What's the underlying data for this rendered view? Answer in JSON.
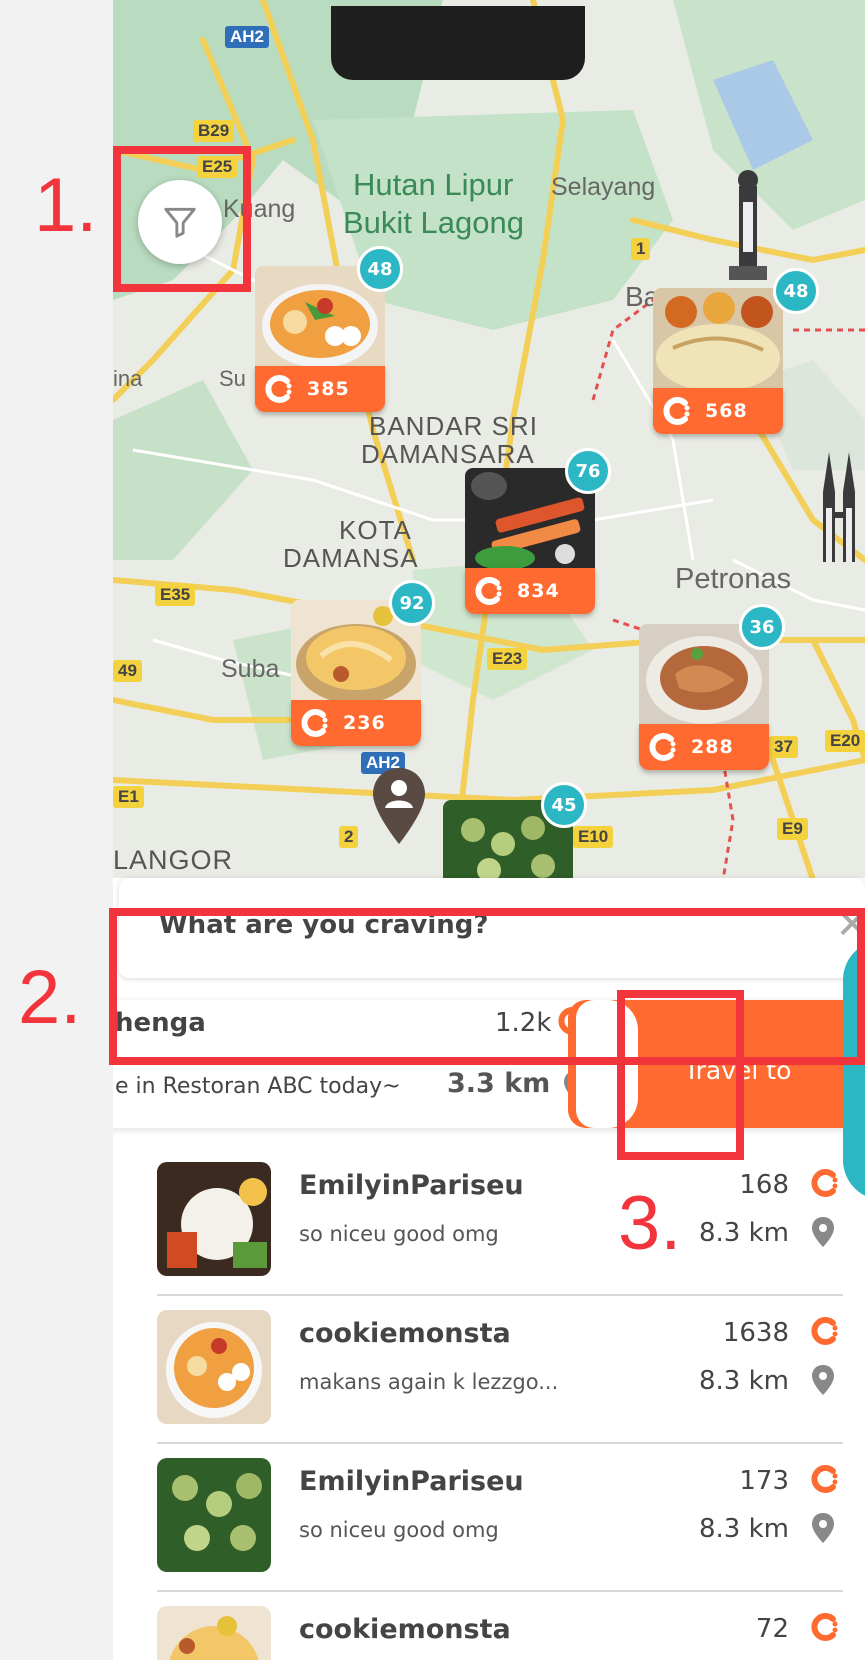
{
  "map": {
    "filter_icon": "filter-icon",
    "labels": {
      "hutan1": "Hutan Lipur",
      "hutan2": "Bukit Lagong",
      "selayang": "Selayang",
      "kuang": "Kuang",
      "bandar1": "BANDAR SRI",
      "bandar2": "DAMANSARA",
      "kota1": "KOTA",
      "kota2": "DAMANSA",
      "petronas": "Petronas",
      "suba": "Suba",
      "ina": "ina",
      "su": "Su",
      "ba": "Ba",
      "langor": "LANGOR"
    },
    "shields": {
      "ah2_top": "AH2",
      "b29": "B29",
      "e25": "E25",
      "e35": "E35",
      "e23": "E23",
      "ah2_mid": "AH2",
      "r2": "2",
      "e10": "E10",
      "e9": "E9",
      "e37": "37",
      "e20": "E20",
      "r1": "1",
      "r49": "49",
      "e1": "E1",
      "e35b": "E35"
    },
    "pins": [
      {
        "badge": "48",
        "value": "385"
      },
      {
        "badge": "48",
        "value": "568"
      },
      {
        "badge": "76",
        "value": "834"
      },
      {
        "badge": "92",
        "value": "236"
      },
      {
        "badge": "36",
        "value": "288"
      },
      {
        "badge": "45",
        "value": ""
      }
    ]
  },
  "search": {
    "placeholder": "What are you craving?",
    "close_icon": "close-icon"
  },
  "featured": {
    "name": "henga",
    "count": "1.2k",
    "description": "e in Restoran ABC today~",
    "distance": "3.3 km",
    "travel_label": "Travel to"
  },
  "list": [
    {
      "user": "EmilyinPariseu",
      "caption": "so niceu good omg",
      "count": "168",
      "distance": "8.3 km"
    },
    {
      "user": "cookiemonsta",
      "caption": "makans again k lezzgo...",
      "count": "1638",
      "distance": "8.3 km"
    },
    {
      "user": "EmilyinPariseu",
      "caption": "so niceu good omg",
      "count": "173",
      "distance": "8.3 km"
    },
    {
      "user": "cookiemonsta",
      "caption": "",
      "count": "72",
      "distance": ""
    }
  ],
  "annotations": {
    "one": "1.",
    "two": "2.",
    "three": "3."
  },
  "colors": {
    "accent": "#ff6a30",
    "teal": "#2bb7c4",
    "annotation": "#f2353c"
  }
}
